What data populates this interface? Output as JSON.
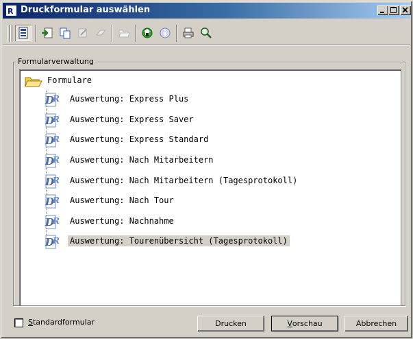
{
  "window": {
    "title": "Druckformular auswählen",
    "icon": "report-designer-icon"
  },
  "caption_buttons": [
    {
      "name": "minimize-button",
      "icon": "minimize-icon"
    },
    {
      "name": "maximize-button",
      "icon": "maximize-icon"
    },
    {
      "name": "close-button",
      "icon": "close-icon"
    }
  ],
  "toolbar": {
    "buttons": [
      {
        "name": "list-view-button",
        "icon": "list-icon",
        "pressed": true
      },
      {
        "name": "import-button",
        "icon": "import-icon"
      },
      {
        "name": "copy-button",
        "icon": "copy-icon"
      },
      {
        "name": "edit-button",
        "icon": "edit-icon",
        "disabled": true
      },
      {
        "name": "delete-button",
        "icon": "eraser-icon",
        "disabled": true
      },
      {
        "name": "open-folder-button",
        "icon": "folder-open-icon",
        "disabled": true
      },
      {
        "name": "update-button",
        "icon": "green-arrow-icon"
      },
      {
        "name": "info-button",
        "icon": "info-icon"
      },
      {
        "name": "print-setup-button",
        "icon": "printer-icon"
      },
      {
        "name": "search-button",
        "icon": "magnifier-icon"
      }
    ]
  },
  "group": {
    "label": "Formularverwaltung"
  },
  "tree": {
    "root_label": "Formulare",
    "items": [
      {
        "label": "Auswertung: Express Plus"
      },
      {
        "label": "Auswertung: Express Saver"
      },
      {
        "label": "Auswertung: Express Standard"
      },
      {
        "label": "Auswertung: Nach Mitarbeitern"
      },
      {
        "label": "Auswertung: Nach Mitarbeitern (Tagesprotokoll)"
      },
      {
        "label": "Auswertung: Nach Tour"
      },
      {
        "label": "Auswertung: Nachnahme"
      },
      {
        "label": "Auswertung: Tourenübersicht (Tagesprotokoll)",
        "selected": true
      }
    ]
  },
  "footer": {
    "checkbox_label_mnemonic": "S",
    "checkbox_label_rest": "tandardformular",
    "checkbox_checked": false,
    "print_label": "Drucken",
    "preview_mnemonic": "V",
    "preview_rest": "orschau",
    "cancel_label": "Abbrechen"
  },
  "colors": {
    "title_gradient_start": "#0a246a",
    "title_gradient_end": "#a6caf0",
    "face": "#d4d0c8",
    "selection": "#d4d0c8"
  }
}
